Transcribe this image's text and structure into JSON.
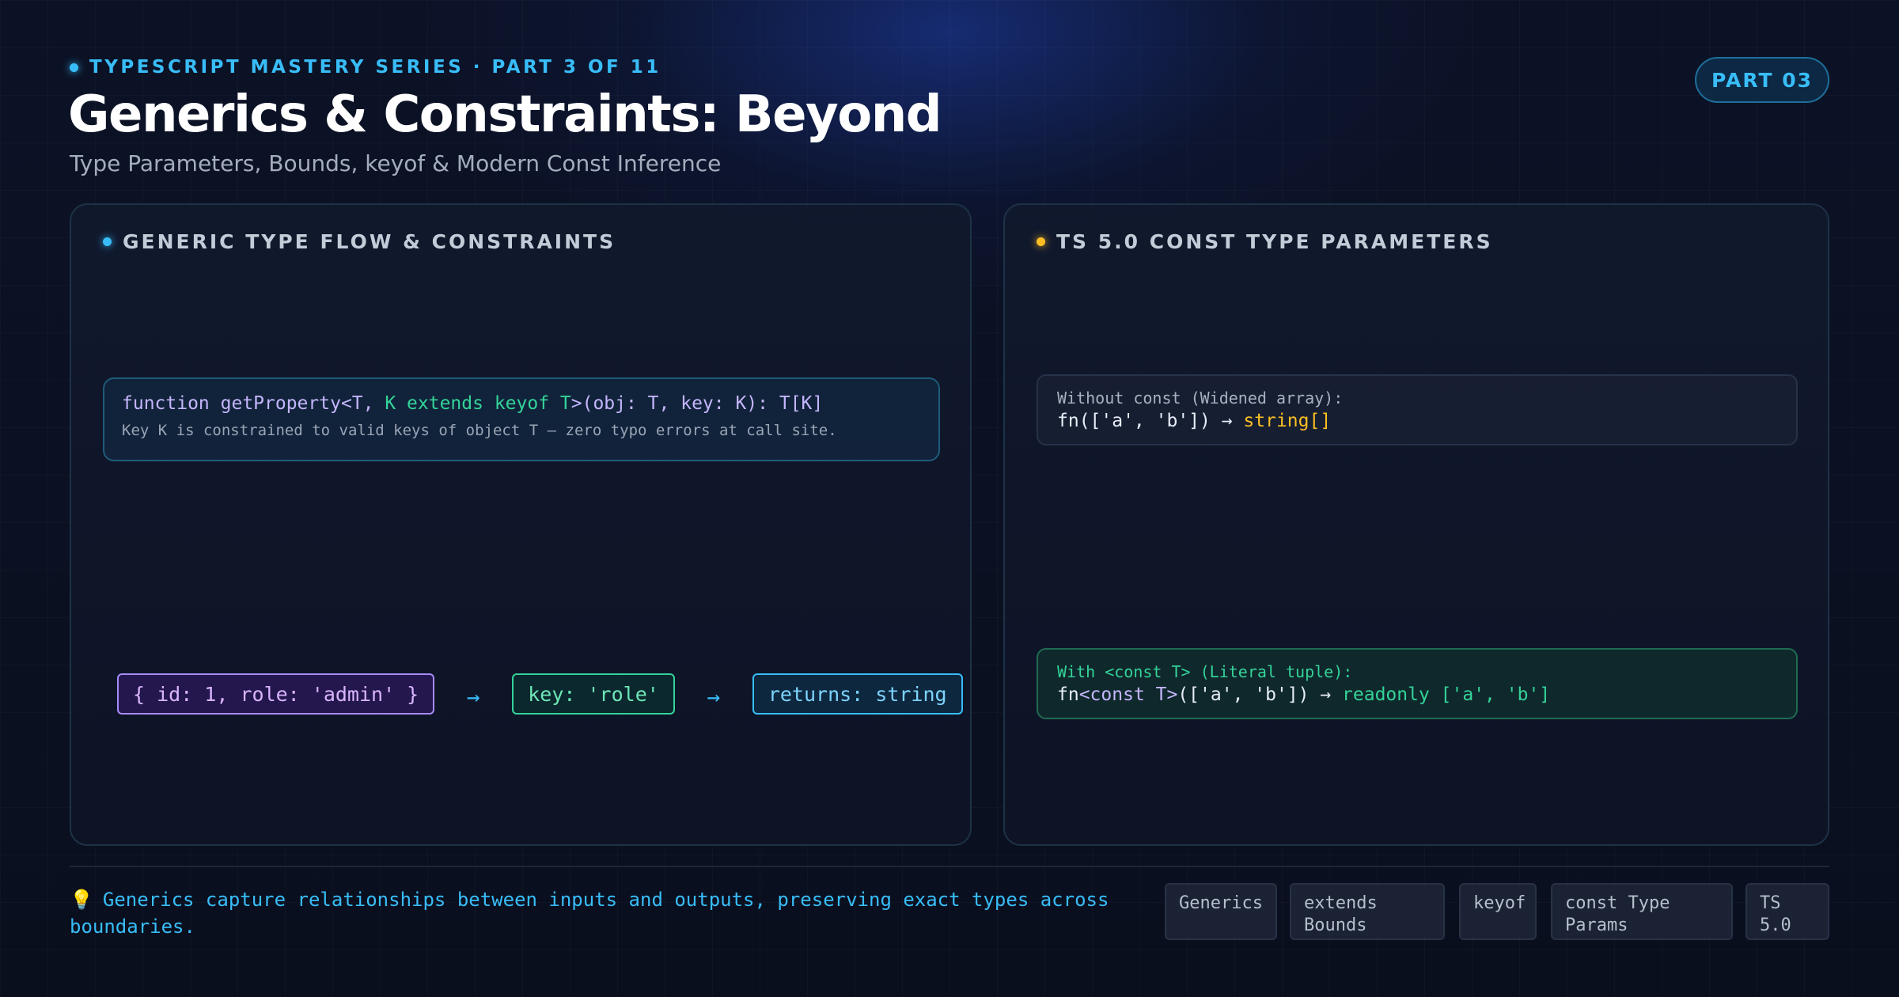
{
  "header": {
    "eyebrow": "TYPESCRIPT MASTERY SERIES · PART 3 OF 11",
    "title": "Generics & Constraints: Beyond",
    "subtitle": "Type Parameters, Bounds, keyof & Modern Const Inference",
    "badge": "PART 03"
  },
  "left_panel": {
    "title": "GENERIC TYPE FLOW & CONSTRAINTS",
    "signature": {
      "s1": "function getProperty<T, ",
      "s2": "K extends keyof T",
      "s3": ">(obj: T, key: K): T[K]",
      "note": "Key K is constrained to valid keys of object T — zero typo errors at call site."
    },
    "flow": {
      "input": "{ id: 1, role: 'admin' }",
      "arrow1": "→",
      "key": "key: 'role'",
      "arrow2": "→",
      "output": "returns: string"
    }
  },
  "right_panel": {
    "title": "TS 5.0 CONST TYPE PARAMETERS",
    "without": {
      "label": "Without const (Widened array):",
      "code": "fn(['a', 'b']) → ",
      "result": "string[]"
    },
    "with": {
      "label": "With <const T> (Literal tuple):",
      "c1": "fn",
      "c2": "<const T>",
      "c3": "(['a', 'b']) → ",
      "result": "readonly ['a', 'b']"
    }
  },
  "footer": {
    "note": "Generics capture relationships between inputs and outputs, preserving exact types across boundaries.",
    "bulb_icon": "lightbulb-icon",
    "tags": [
      "Generics",
      "extends Bounds",
      "keyof",
      "const Type Params",
      "TS 5.0"
    ]
  },
  "colors": {
    "accent": "#38bdf8",
    "purple": "#a78bfa",
    "green": "#34d399",
    "amber": "#fbbf24"
  }
}
